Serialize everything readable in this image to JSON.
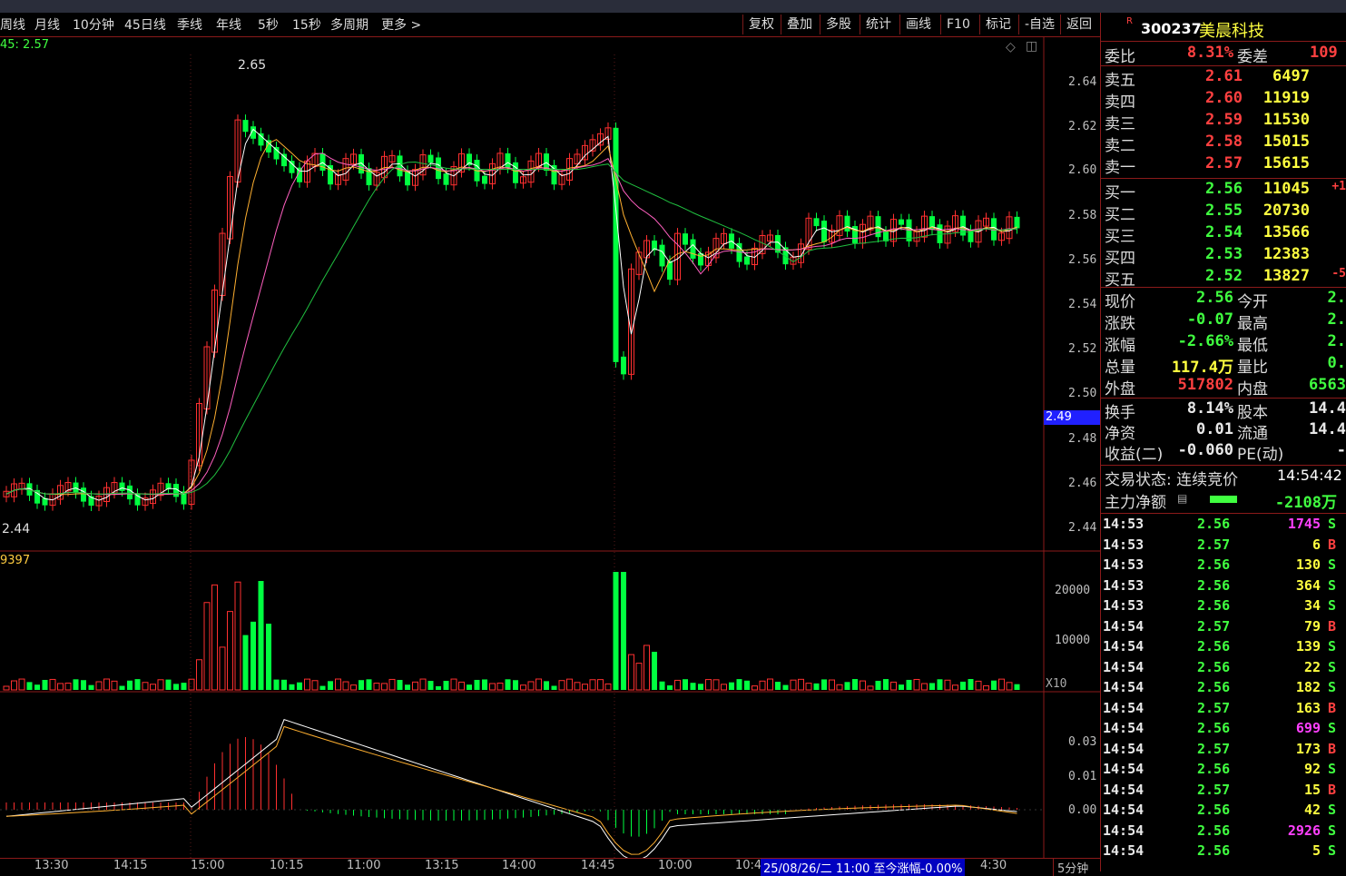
{
  "toolbar": {
    "periods": [
      "周线",
      "月线",
      "10分钟",
      "45日线",
      "季线",
      "年线",
      "5秒",
      "15秒",
      "多周期",
      "更多 >"
    ],
    "actions": [
      "复权",
      "叠加",
      "多股",
      "统计",
      "画线",
      "F10",
      "标记",
      "-自选",
      "返回"
    ]
  },
  "chart": {
    "ma_label": "45: 2.57",
    "high_label": "2.65",
    "low_label": "2.44",
    "price_ticks": [
      "2.64",
      "2.62",
      "2.60",
      "2.58",
      "2.56",
      "2.54",
      "2.52",
      "2.50",
      "2.48",
      "2.46",
      "2.44"
    ],
    "current_price_tag": "2.49",
    "volume_label": "9397",
    "volume_ticks": [
      "20000",
      "10000"
    ],
    "volume_unit": "X10",
    "macd_ticks": [
      "0.03",
      "0.01",
      "0.00"
    ],
    "x_ticks": [
      "13:30",
      "14:15",
      "15:00",
      "10:15",
      "11:00",
      "13:15",
      "14:00",
      "14:45",
      "10:00",
      "10:4"
    ],
    "status_text": "25/08/26/二 11:00  至今涨幅-0.00%",
    "status_right": "4:30",
    "period": "5分钟"
  },
  "chart_data": {
    "type": "candlestick",
    "title": "300237 美晨科技 5分钟",
    "ylim": [
      2.43,
      2.66
    ],
    "notes": "5-minute K-line with MA lines, volume bars and MACD; values approximate"
  },
  "quote": {
    "code_badge": "R",
    "code": "300237",
    "name": "美晨科技",
    "weibi_label": "委比",
    "weibi_value": "8.31%",
    "weicha_label": "委差",
    "weicha_value": "109",
    "asks": [
      {
        "label": "卖五",
        "price": "2.61",
        "vol": "6497"
      },
      {
        "label": "卖四",
        "price": "2.60",
        "vol": "11919"
      },
      {
        "label": "卖三",
        "price": "2.59",
        "vol": "11530"
      },
      {
        "label": "卖二",
        "price": "2.58",
        "vol": "15015"
      },
      {
        "label": "卖一",
        "price": "2.57",
        "vol": "15615"
      }
    ],
    "bids": [
      {
        "label": "买一",
        "price": "2.56",
        "vol": "11045",
        "extra": "+1"
      },
      {
        "label": "买二",
        "price": "2.55",
        "vol": "20730",
        "extra": ""
      },
      {
        "label": "买三",
        "price": "2.54",
        "vol": "13566",
        "extra": ""
      },
      {
        "label": "买四",
        "price": "2.53",
        "vol": "12383",
        "extra": ""
      },
      {
        "label": "买五",
        "price": "2.52",
        "vol": "13827",
        "extra": "-5"
      }
    ],
    "stats": [
      {
        "l1": "现价",
        "v1": "2.56",
        "c1": "dn",
        "l2": "今开",
        "v2": "2."
      },
      {
        "l1": "涨跌",
        "v1": "-0.07",
        "c1": "dn",
        "l2": "最高",
        "v2": "2."
      },
      {
        "l1": "涨幅",
        "v1": "-2.66%",
        "c1": "dn",
        "l2": "最低",
        "v2": "2."
      },
      {
        "l1": "总量",
        "v1": "117.4万",
        "c1": "yl",
        "l2": "量比",
        "v2": "0."
      },
      {
        "l1": "外盘",
        "v1": "517802",
        "c1": "up",
        "l2": "内盘",
        "v2": "6563"
      }
    ],
    "stats2": [
      {
        "l1": "换手",
        "v1": "8.14%",
        "l2": "股本",
        "v2": "14.4"
      },
      {
        "l1": "净资",
        "v1": "0.01",
        "l2": "流通",
        "v2": "14.4"
      },
      {
        "l1": "收益(二)",
        "v1": "-0.060",
        "l2": "PE(动)",
        "v2": "-"
      }
    ],
    "status_label": "交易状态: 连续竞价",
    "status_time": "14:54:42",
    "main_flow_label": "主力净额",
    "main_flow_value": "-2108万",
    "trades": [
      {
        "t": "14:53",
        "p": "2.56",
        "pc": "dn",
        "v": "1745",
        "vc": "mg",
        "s": "S"
      },
      {
        "t": "14:53",
        "p": "2.57",
        "pc": "dn",
        "v": "6",
        "vc": "yl",
        "s": "B"
      },
      {
        "t": "14:53",
        "p": "2.56",
        "pc": "dn",
        "v": "130",
        "vc": "yl",
        "s": "S"
      },
      {
        "t": "14:53",
        "p": "2.56",
        "pc": "dn",
        "v": "364",
        "vc": "yl",
        "s": "S"
      },
      {
        "t": "14:53",
        "p": "2.56",
        "pc": "dn",
        "v": "34",
        "vc": "yl",
        "s": "S"
      },
      {
        "t": "14:54",
        "p": "2.57",
        "pc": "dn",
        "v": "79",
        "vc": "yl",
        "s": "B"
      },
      {
        "t": "14:54",
        "p": "2.56",
        "pc": "dn",
        "v": "139",
        "vc": "yl",
        "s": "S"
      },
      {
        "t": "14:54",
        "p": "2.56",
        "pc": "dn",
        "v": "22",
        "vc": "yl",
        "s": "S"
      },
      {
        "t": "14:54",
        "p": "2.56",
        "pc": "dn",
        "v": "182",
        "vc": "yl",
        "s": "S"
      },
      {
        "t": "14:54",
        "p": "2.57",
        "pc": "dn",
        "v": "163",
        "vc": "yl",
        "s": "B"
      },
      {
        "t": "14:54",
        "p": "2.56",
        "pc": "dn",
        "v": "699",
        "vc": "mg",
        "s": "S"
      },
      {
        "t": "14:54",
        "p": "2.57",
        "pc": "dn",
        "v": "173",
        "vc": "yl",
        "s": "B"
      },
      {
        "t": "14:54",
        "p": "2.56",
        "pc": "dn",
        "v": "92",
        "vc": "yl",
        "s": "S"
      },
      {
        "t": "14:54",
        "p": "2.57",
        "pc": "dn",
        "v": "15",
        "vc": "yl",
        "s": "B"
      },
      {
        "t": "14:54",
        "p": "2.56",
        "pc": "dn",
        "v": "42",
        "vc": "yl",
        "s": "S"
      },
      {
        "t": "14:54",
        "p": "2.56",
        "pc": "dn",
        "v": "2926",
        "vc": "mg",
        "s": "S"
      },
      {
        "t": "14:54",
        "p": "2.56",
        "pc": "dn",
        "v": "5",
        "vc": "yl",
        "s": "S"
      }
    ]
  }
}
